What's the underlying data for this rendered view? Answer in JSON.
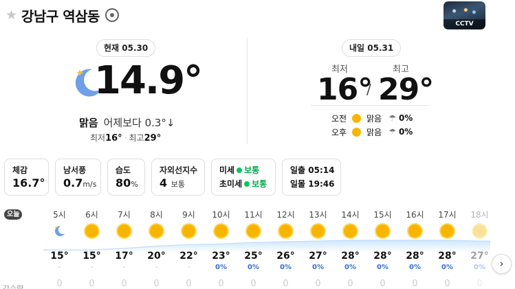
{
  "header": {
    "location": "강남구 역삼동",
    "favorite_icon": "★",
    "cctv_label": "CCTV"
  },
  "current": {
    "date_pill": "현재 05.30",
    "temperature": "14.9°",
    "condition": "맑음",
    "compare": "어제보다 0.3°↓",
    "min_label": "최저",
    "min": "16°",
    "separator": "·",
    "max_label": "최고",
    "max": "29°"
  },
  "tomorrow": {
    "date_pill": "내일 05.31",
    "min_label": "최저",
    "max_label": "최고",
    "min": "16°",
    "slash": "/",
    "max": "29°",
    "am": {
      "label": "오전",
      "condition": "맑음",
      "precip": "0%"
    },
    "pm": {
      "label": "오후",
      "condition": "맑음",
      "precip": "0%"
    }
  },
  "cards": {
    "feel": {
      "label": "체감",
      "value": "16.7°"
    },
    "wind": {
      "label": "남서풍",
      "value": "0.7",
      "unit": "m/s"
    },
    "humidity": {
      "label": "습도",
      "value": "80",
      "unit": "%"
    },
    "uv": {
      "label": "자외선지수",
      "value": "4",
      "unit": "보통"
    },
    "dust": {
      "pm10_label": "미세",
      "pm10_value": "보통",
      "pm25_label": "초미세",
      "pm25_value": "보통"
    },
    "sun": {
      "rise_label": "일출",
      "rise": "05:14",
      "set_label": "일몰",
      "set": "19:46"
    }
  },
  "hourly": {
    "today_tag": "오늘",
    "rain_label": "강수량",
    "hours": [
      {
        "time": "5시",
        "temp": "15°",
        "precip": "-",
        "rain": "0",
        "icon": "moon"
      },
      {
        "time": "6시",
        "temp": "15°",
        "precip": "-",
        "rain": "0",
        "icon": "sun"
      },
      {
        "time": "7시",
        "temp": "17°",
        "precip": "-",
        "rain": "0",
        "icon": "sun"
      },
      {
        "time": "8시",
        "temp": "20°",
        "precip": "-",
        "rain": "0",
        "icon": "sun"
      },
      {
        "time": "9시",
        "temp": "22°",
        "precip": "-",
        "rain": "0",
        "icon": "sun"
      },
      {
        "time": "10시",
        "temp": "23°",
        "precip": "0%",
        "rain": "0",
        "icon": "sun"
      },
      {
        "time": "11시",
        "temp": "25°",
        "precip": "0%",
        "rain": "0",
        "icon": "sun"
      },
      {
        "time": "12시",
        "temp": "26°",
        "precip": "0%",
        "rain": "0",
        "icon": "sun"
      },
      {
        "time": "13시",
        "temp": "27°",
        "precip": "0%",
        "rain": "0",
        "icon": "sun"
      },
      {
        "time": "14시",
        "temp": "28°",
        "precip": "0%",
        "rain": "0",
        "icon": "sun"
      },
      {
        "time": "15시",
        "temp": "28°",
        "precip": "0%",
        "rain": "0",
        "icon": "sun"
      },
      {
        "time": "16시",
        "temp": "28°",
        "precip": "0%",
        "rain": "0",
        "icon": "sun"
      },
      {
        "time": "17시",
        "temp": "28°",
        "precip": "0%",
        "rain": "0",
        "icon": "sun"
      },
      {
        "time": "18시",
        "temp": "27°",
        "precip": "0%",
        "rain": "0",
        "icon": "sun"
      }
    ]
  },
  "colors": {
    "sun": "#f7b500",
    "moon": "#6f9fe8",
    "good": "#03c75a",
    "precip": "#2f6ed8"
  },
  "icons": {
    "next": "›",
    "umbrella": "☂",
    "gps": "gps-icon"
  }
}
